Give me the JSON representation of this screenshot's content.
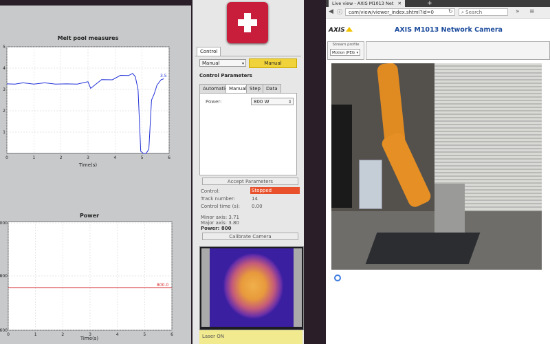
{
  "charts": {
    "melt_pool": {
      "title": "Melt pool measures",
      "xlabel": "Time(s)",
      "x_ticks": [
        "0",
        "1",
        "2",
        "3",
        "4",
        "5",
        "6"
      ],
      "y_ticks": [
        "5",
        "4",
        "3",
        "2",
        "1"
      ],
      "end_label": "3.5"
    },
    "power": {
      "title": "Power",
      "xlabel": "Time(s)",
      "x_ticks": [
        "0",
        "1",
        "2",
        "3",
        "4",
        "5",
        "6"
      ],
      "y_ticks": [
        "000",
        "800",
        "600"
      ],
      "end_label": "800.0"
    }
  },
  "chart_data": [
    {
      "type": "line",
      "title": "Melt pool measures",
      "xlabel": "Time(s)",
      "ylabel": "",
      "xlim": [
        0,
        6
      ],
      "ylim": [
        0,
        5
      ],
      "series": [
        {
          "color": "#1f2fd6",
          "x": [
            0,
            0.3,
            0.6,
            1.0,
            1.4,
            1.8,
            2.2,
            2.6,
            3.0,
            3.1,
            3.5,
            3.9,
            4.2,
            4.5,
            4.65,
            4.75,
            4.85,
            4.95,
            5.05,
            5.15,
            5.25,
            5.35,
            5.45,
            5.55,
            5.7,
            5.8
          ],
          "y": [
            3.2,
            3.3,
            3.25,
            3.3,
            3.25,
            3.3,
            3.2,
            3.3,
            3.3,
            3.1,
            3.4,
            3.5,
            3.6,
            3.7,
            3.75,
            3.6,
            3.0,
            0.1,
            0.0,
            0.0,
            0.2,
            2.5,
            2.8,
            3.2,
            3.45,
            3.5
          ]
        }
      ]
    },
    {
      "type": "line",
      "title": "Power",
      "xlabel": "Time(s)",
      "ylabel": "",
      "xlim": [
        0,
        6
      ],
      "series": [
        {
          "color": "#d62728",
          "x": [
            0,
            6
          ],
          "y": [
            800,
            800
          ]
        }
      ]
    }
  ],
  "control": {
    "tab": "Control",
    "mode_select": "Manual",
    "mode_indicator": "Manual",
    "params_heading": "Control Parameters",
    "subtabs": [
      "Automatic",
      "Manual",
      "Step",
      "Data"
    ],
    "power_label": "Power:",
    "power_value": "800 W",
    "accept_button": "Accept Parameters",
    "status": {
      "control_label": "Control:",
      "control_value": "Stopped",
      "track_label": "Track number:",
      "track_value": "14",
      "time_label": "Control time (s):",
      "time_value": "0.00"
    },
    "minor_axis": "Minor axis: 3.71",
    "major_axis": "Major axis: 3.80",
    "power_readout": "Power: 800",
    "calibrate_button": "Calibrate Camera",
    "laser_status": "Laser ON",
    "colors": {
      "stopped": "#e8512b",
      "manual": "#f0d23a",
      "laser_bar": "#f1ea8e",
      "logo": "#c81e3c"
    }
  },
  "browser": {
    "tab_title": "Live view - AXIS M1013 Net",
    "url": "cam/view/viewer_index.shtml?id=0",
    "search_placeholder": "Search",
    "logo_text": "AXIS",
    "camera_title": "AXIS M1013 Network Camera",
    "stream_profile_label": "Stream profile",
    "stream_profile_value": "Motion JPEG"
  }
}
